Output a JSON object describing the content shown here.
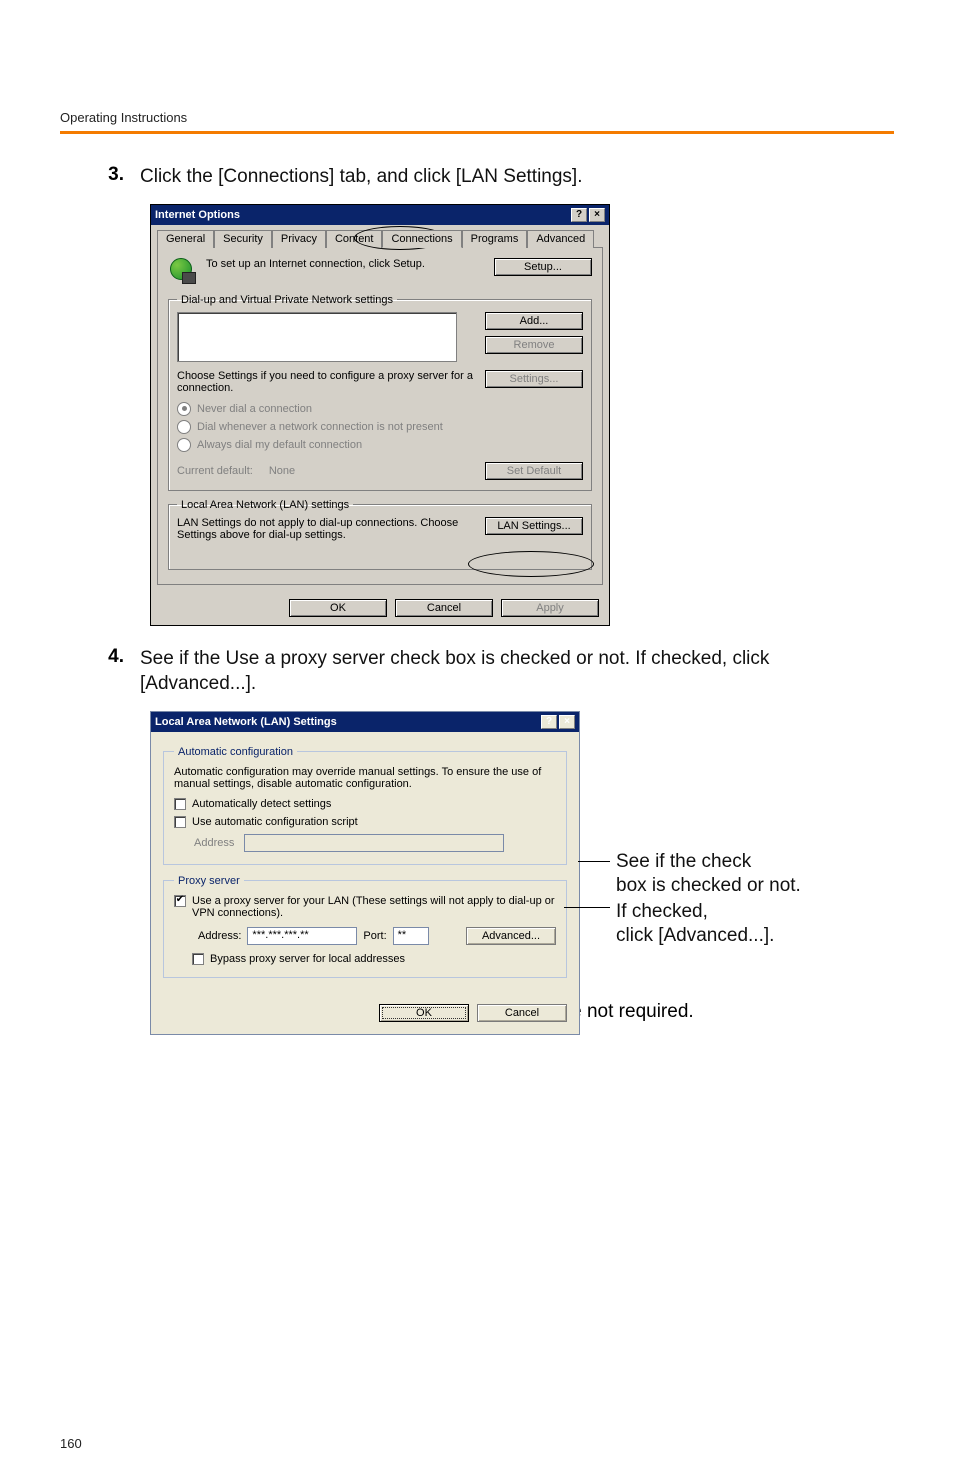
{
  "header": {
    "title": "Operating Instructions"
  },
  "steps": {
    "s3": {
      "num": "3.",
      "text": "Click the [Connections] tab, and click [LAN Settings]."
    },
    "s4": {
      "num": "4.",
      "text": "See if the Use a proxy server check box is checked or not. If checked, click [Advanced...]."
    },
    "bullet_text": "If not checked, click [Cancel]. Proxy settings are not required."
  },
  "dialog1": {
    "title": "Internet Options",
    "help_btn": "?",
    "close_btn": "×",
    "tabs": [
      "General",
      "Security",
      "Privacy",
      "Content",
      "Connections",
      "Programs",
      "Advanced"
    ],
    "setup_hint": "To set up an Internet connection, click Setup.",
    "setup_btn": "Setup...",
    "group_dialup": "Dial-up and Virtual Private Network settings",
    "add_btn": "Add...",
    "remove_btn": "Remove",
    "choose_settings_text": "Choose Settings if you need to configure a proxy server for a connection.",
    "settings_btn": "Settings...",
    "radio_never": "Never dial a connection",
    "radio_whenever": "Dial whenever a network connection is not present",
    "radio_always": "Always dial my default connection",
    "current_default_label": "Current default:",
    "current_default_value": "None",
    "set_default_btn": "Set Default",
    "group_lan": "Local Area Network (LAN) settings",
    "lan_text": "LAN Settings do not apply to dial-up connections. Choose Settings above for dial-up settings.",
    "lan_btn": "LAN Settings...",
    "ok_btn": "OK",
    "cancel_btn": "Cancel",
    "apply_btn": "Apply"
  },
  "dialog2": {
    "title": "Local Area Network (LAN) Settings",
    "help_btn": "?",
    "close_btn": "×",
    "group_auto": "Automatic configuration",
    "auto_text": "Automatic configuration may override manual settings.  To ensure the use of manual settings, disable automatic configuration.",
    "cb_detect": "Automatically detect settings",
    "cb_script": "Use automatic configuration script",
    "address_label_disabled": "Address",
    "group_proxy": "Proxy server",
    "cb_useproxy": "Use a proxy server for your LAN (These settings will not apply to dial-up or VPN connections).",
    "address_label": "Address:",
    "address_value": "***.***.***.**",
    "port_label": "Port:",
    "port_value": "**",
    "advanced_btn": "Advanced...",
    "cb_bypass": "Bypass proxy server for local addresses",
    "ok_btn": "OK",
    "cancel_btn": "Cancel"
  },
  "annotations": {
    "line1": "See if the check",
    "line2": "box is checked or not.",
    "line3": "If checked,",
    "line4": "click [Advanced...]."
  },
  "page_number": "160"
}
